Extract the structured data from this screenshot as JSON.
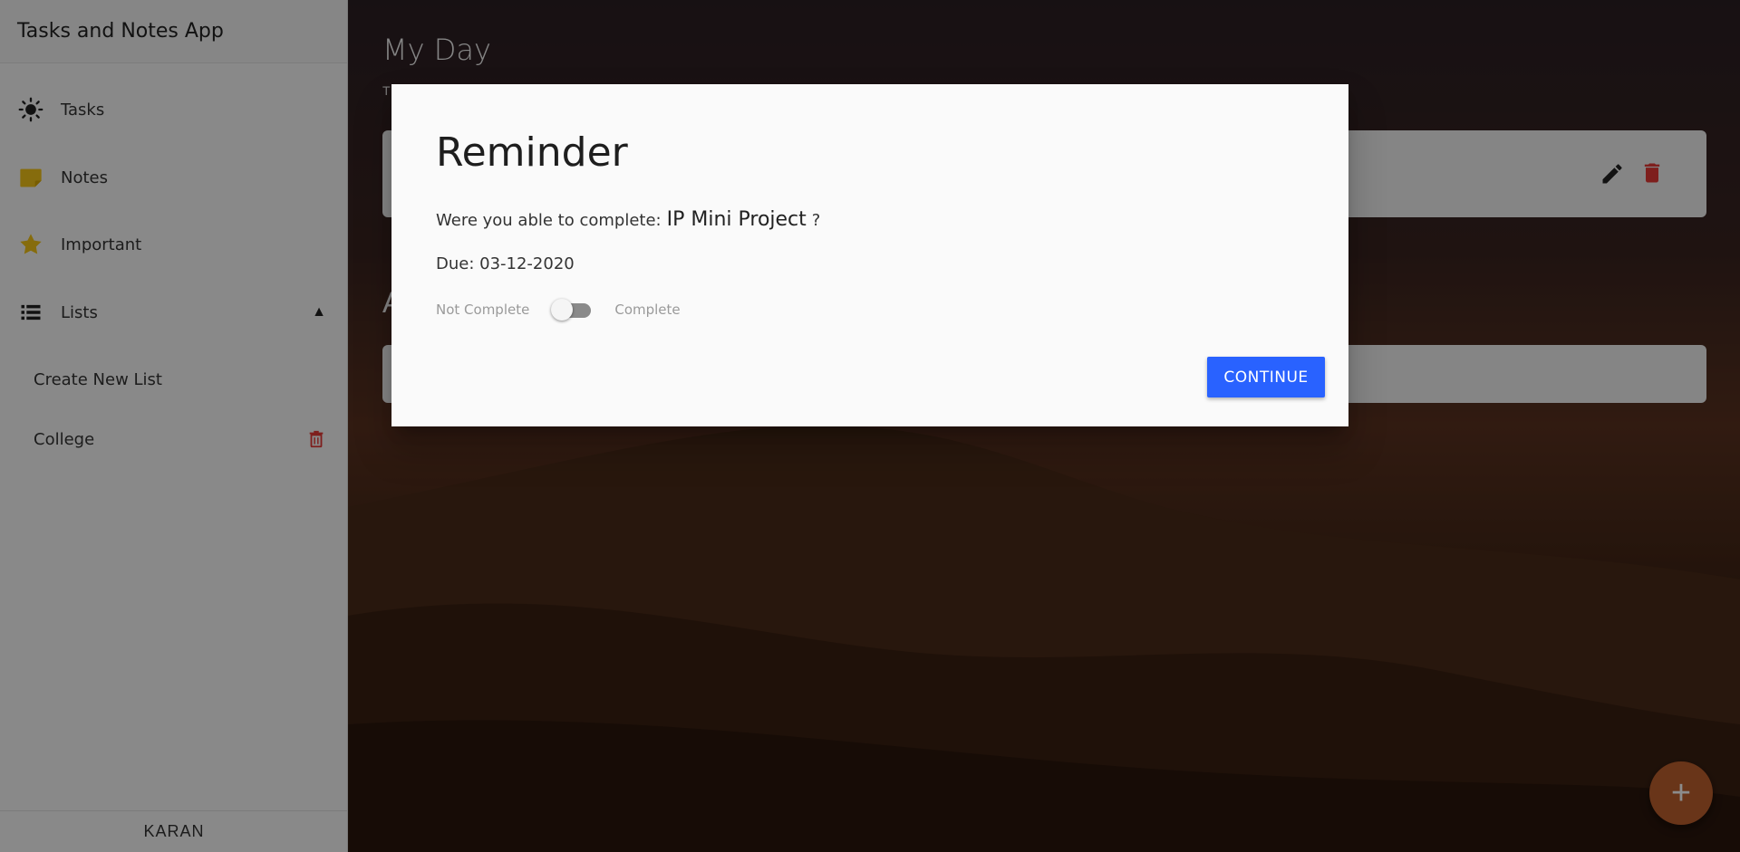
{
  "app": {
    "title": "Tasks and Notes App"
  },
  "sidebar": {
    "items": [
      {
        "label": "Tasks",
        "icon": "sun-icon"
      },
      {
        "label": "Notes",
        "icon": "note-icon"
      },
      {
        "label": "Important",
        "icon": "star-icon"
      },
      {
        "label": "Lists",
        "icon": "list-icon"
      }
    ],
    "lists_caret": "▲",
    "lists": [
      {
        "label": "Create New List"
      },
      {
        "label": "College"
      }
    ],
    "user": "KARAN"
  },
  "main": {
    "page_title": "My Day",
    "page_sub": "T",
    "section_title": "A",
    "fab_label": "+"
  },
  "dialog": {
    "title": "Reminder",
    "question": "Were you able to complete:",
    "task_name": "IP Mini Project",
    "question_mark": "?",
    "due": "Due: 03-12-2020",
    "switch_off_label": "Not Complete",
    "switch_on_label": "Complete",
    "switch_checked": false,
    "continue_label": "CONTINUE"
  },
  "colors": {
    "accent": "#2962ff",
    "delete": "#e53935",
    "notes_icon": "#f5c518",
    "star_icon": "#f5c518",
    "fab": "#c0612f"
  }
}
